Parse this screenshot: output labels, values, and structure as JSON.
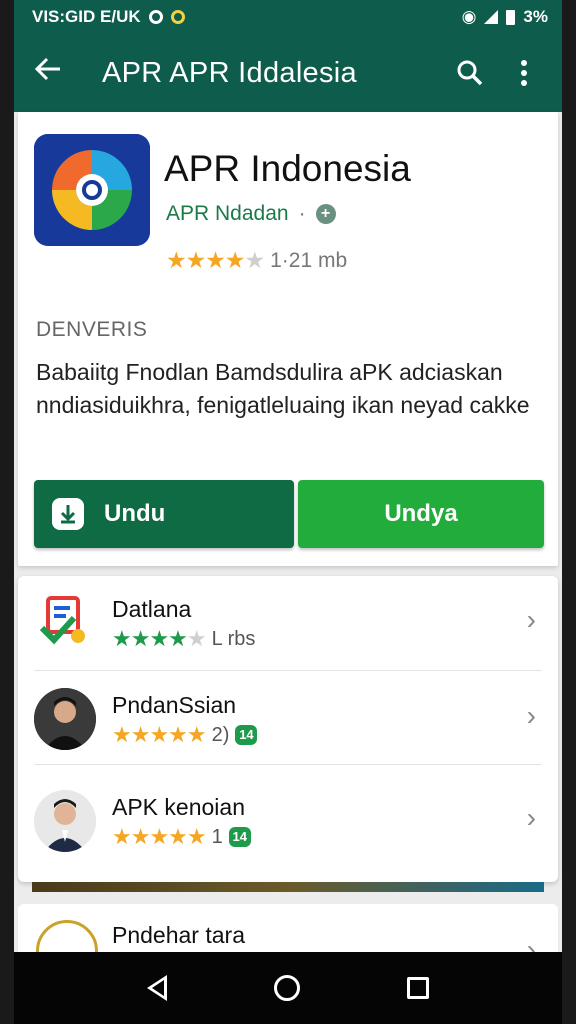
{
  "status_bar": {
    "time": "VIS:GID E/UK",
    "battery": "3%"
  },
  "app_bar": {
    "title": "APR APR Iddalesia"
  },
  "app": {
    "name": "APR Indonesia",
    "developer": "APR Ndadan",
    "rating_stars": 3.5,
    "size": "1·21 mb",
    "section_label": "DENVERIS",
    "description": "Babaiitg Fnodlan Bamdsdulira aPK adciaskan nndiasiduikhra, fenigatleluaing ikan neyad cakke",
    "primary_button": "Undu",
    "secondary_button": "Undya"
  },
  "related": [
    {
      "name": "Datlana",
      "rating_stars": 3.5,
      "meta": "L rbs",
      "badge": ""
    },
    {
      "name": "PndanSsian",
      "rating_stars": 4.5,
      "meta": "2)",
      "badge": "14"
    },
    {
      "name": "APK kenoian",
      "rating_stars": 4.5,
      "meta": "1",
      "badge": "14"
    }
  ],
  "peek": {
    "name": "Pndehar tara"
  },
  "colors": {
    "primary": "#0d5c4c",
    "button_dark": "#0f6b44",
    "button_light": "#22ac3c",
    "star": "#f5a623"
  }
}
